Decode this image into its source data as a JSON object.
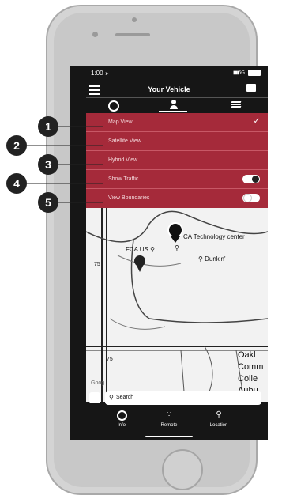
{
  "status_bar": {
    "time": "1:00",
    "signal": "5G"
  },
  "header": {
    "title": "Your Vehicle"
  },
  "top_tabs": [
    {
      "icon": "steering-wheel-icon"
    },
    {
      "icon": "person-icon",
      "active": true
    },
    {
      "icon": "layers-icon"
    }
  ],
  "map_menu": {
    "items": [
      {
        "label": "Map View",
        "selected": true
      },
      {
        "label": "Satellite View"
      },
      {
        "label": "Hybrid View"
      },
      {
        "label": "Show Traffic",
        "toggle_on": true
      },
      {
        "label": "View Boundaries",
        "toggle_on": false
      }
    ]
  },
  "callouts": [
    "1",
    "2",
    "3",
    "4",
    "5"
  ],
  "map": {
    "labels": {
      "tech_center": "CA Technology center",
      "dunkin": "Dunkin'",
      "fca_us": "FCA US",
      "oakl": "Oakl",
      "comm": "Comm",
      "colle": "Colle",
      "aubu": "Aubu",
      "google": "Goog",
      "road_75_a": "75",
      "road_75_b": "75"
    }
  },
  "search": {
    "placeholder": "Search"
  },
  "bottom_tabs": [
    {
      "label": "Info",
      "icon": "steering-wheel-icon"
    },
    {
      "label": "Remote",
      "icon": "remote-icon"
    },
    {
      "label": "Location",
      "icon": "location-pin-icon"
    }
  ],
  "colors": {
    "menu_bg": "#a52a3a",
    "screen_bg": "#161616"
  }
}
